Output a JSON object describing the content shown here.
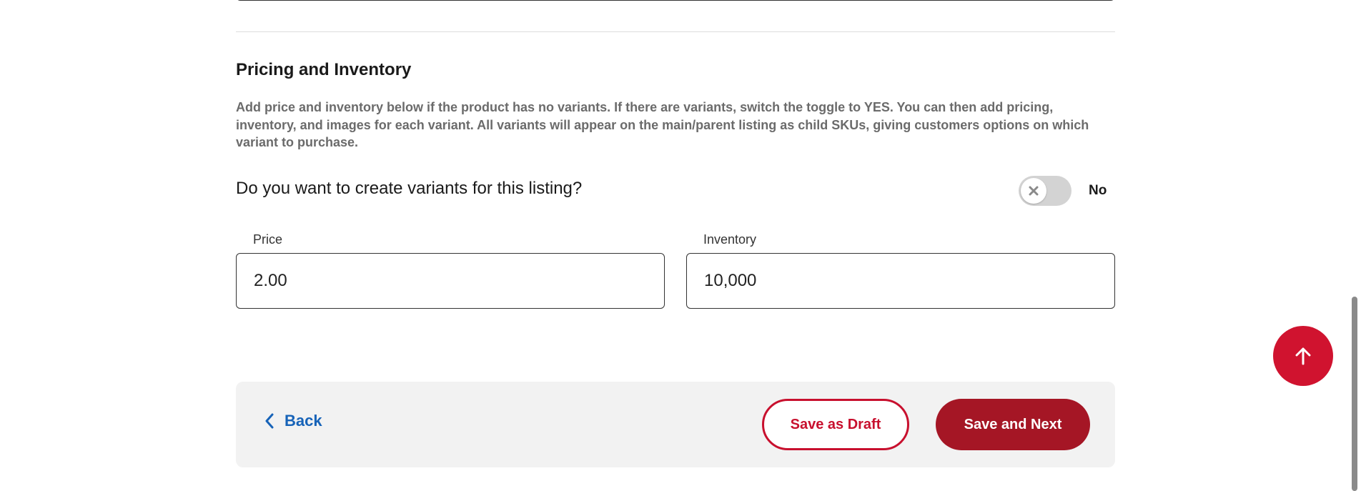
{
  "section": {
    "title": "Pricing and Inventory",
    "description": "Add price and inventory below if the product has no variants. If there are variants, switch the toggle to YES. You can then add pricing, inventory, and images for each variant. All variants will appear on the main/parent listing as child SKUs, giving customers options on which variant to purchase."
  },
  "variants": {
    "question": "Do you want to create variants for this listing?",
    "toggle_on": false,
    "toggle_state_label": "No"
  },
  "fields": {
    "price": {
      "label": "Price",
      "value": "2.00"
    },
    "inventory": {
      "label": "Inventory",
      "value": "10,000"
    }
  },
  "actions": {
    "back_label": "Back",
    "save_draft_label": "Save as Draft",
    "save_next_label": "Save and Next"
  },
  "icons": {
    "back": "chevron-left-icon",
    "toggle_off": "close-icon",
    "scroll_top": "arrow-up-icon"
  },
  "colors": {
    "accent_red": "#c8102e",
    "dark_red": "#a51625",
    "link_blue": "#1763b8",
    "bar_bg": "#f2f2f2"
  }
}
